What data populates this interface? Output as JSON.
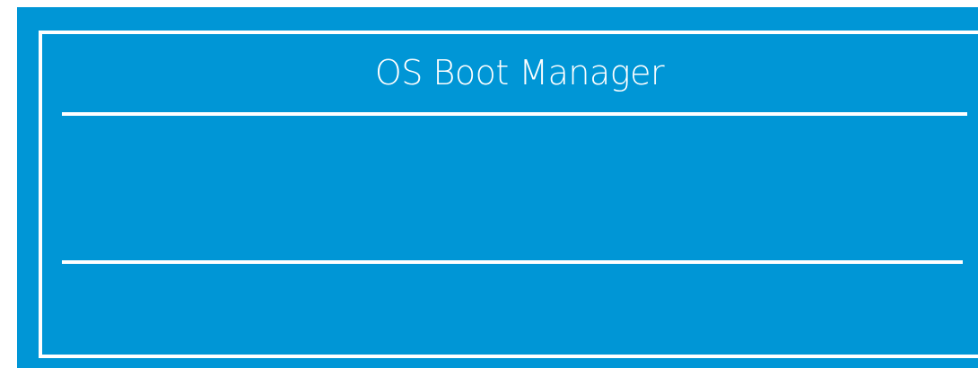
{
  "boot_manager": {
    "title": "OS Boot Manager"
  },
  "colors": {
    "background": "#0096d6",
    "foreground": "#ffffff"
  }
}
